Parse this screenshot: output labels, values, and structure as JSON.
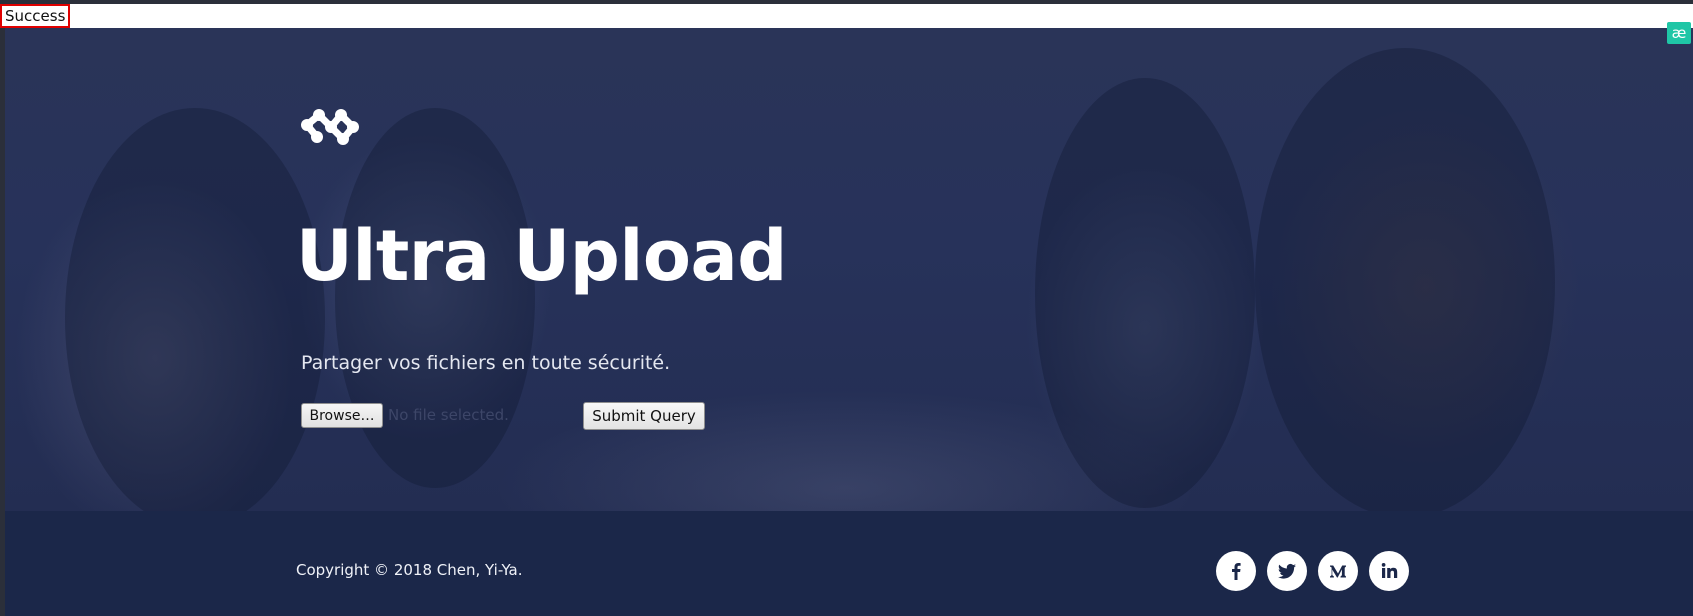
{
  "status": {
    "text": "Success"
  },
  "extension": {
    "glyph": "æ",
    "icon": "translate-extension-icon"
  },
  "hero": {
    "logo_icon": "molecule-logo-icon",
    "title": "Ultra Upload",
    "subtitle": "Partager vos fichiers en toute sécurité.",
    "form": {
      "browse_label": "Browse…",
      "file_status": "No file selected.",
      "submit_label": "Submit Query"
    }
  },
  "footer": {
    "copyright": "Copyright © 2018 Chen, Yi-Ya.",
    "social": [
      {
        "name": "facebook-icon",
        "glyph": "f"
      },
      {
        "name": "twitter-icon",
        "glyph": "twitter"
      },
      {
        "name": "medium-icon",
        "glyph": "M"
      },
      {
        "name": "linkedin-icon",
        "glyph": "in"
      }
    ]
  },
  "colors": {
    "hero_overlay": "#27325a",
    "footer_bg": "#1b2749",
    "status_border": "#e00000",
    "extension_accent": "#1fc6a6"
  }
}
